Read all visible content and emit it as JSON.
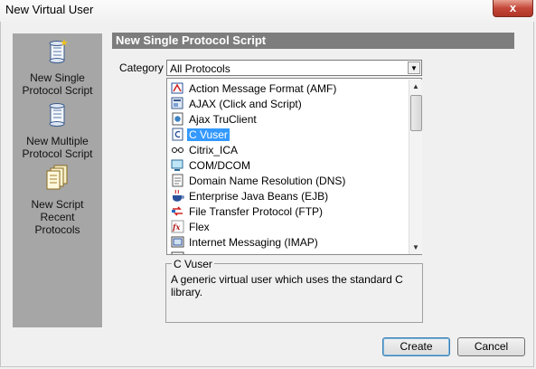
{
  "window": {
    "title": "New Virtual User",
    "close_glyph": "x"
  },
  "sidebar": {
    "items": [
      {
        "label_line1": "New Single",
        "label_line2": "Protocol Script",
        "icon": "script-scroll-icon"
      },
      {
        "label_line1": "New Multiple",
        "label_line2": "Protocol Script",
        "icon": "multi-script-scroll-icon"
      },
      {
        "label_line1": "New Script",
        "label_line2": "Recent",
        "label_line3": "Protocols",
        "icon": "recent-scripts-icon"
      }
    ]
  },
  "main": {
    "header": "New Single Protocol Script",
    "category_label": "Category :",
    "category_value": "All Protocols",
    "protocols": [
      {
        "label": "Action Message Format (AMF)",
        "icon": "amf-icon"
      },
      {
        "label": "AJAX (Click and Script)",
        "icon": "ajax-icon"
      },
      {
        "label": "Ajax TruClient",
        "icon": "truclient-icon"
      },
      {
        "label": "C Vuser",
        "icon": "c-vuser-icon",
        "selected": true
      },
      {
        "label": "Citrix_ICA",
        "icon": "citrix-icon"
      },
      {
        "label": "COM/DCOM",
        "icon": "com-dcom-icon"
      },
      {
        "label": "Domain Name Resolution (DNS)",
        "icon": "dns-icon"
      },
      {
        "label": "Enterprise Java Beans (EJB)",
        "icon": "ejb-icon"
      },
      {
        "label": "File Transfer Protocol (FTP)",
        "icon": "ftp-icon"
      },
      {
        "label": "Flex",
        "icon": "flex-icon"
      },
      {
        "label": "Internet Messaging (IMAP)",
        "icon": "imap-icon"
      }
    ],
    "description_title": "C Vuser",
    "description_text": "A generic virtual user which uses the standard C library."
  },
  "buttons": {
    "create": "Create",
    "cancel": "Cancel"
  },
  "colors": {
    "sidebar": "#a6a6a6",
    "header": "#7d7d7d",
    "selection": "#3399ff",
    "close": "#c4473a"
  }
}
